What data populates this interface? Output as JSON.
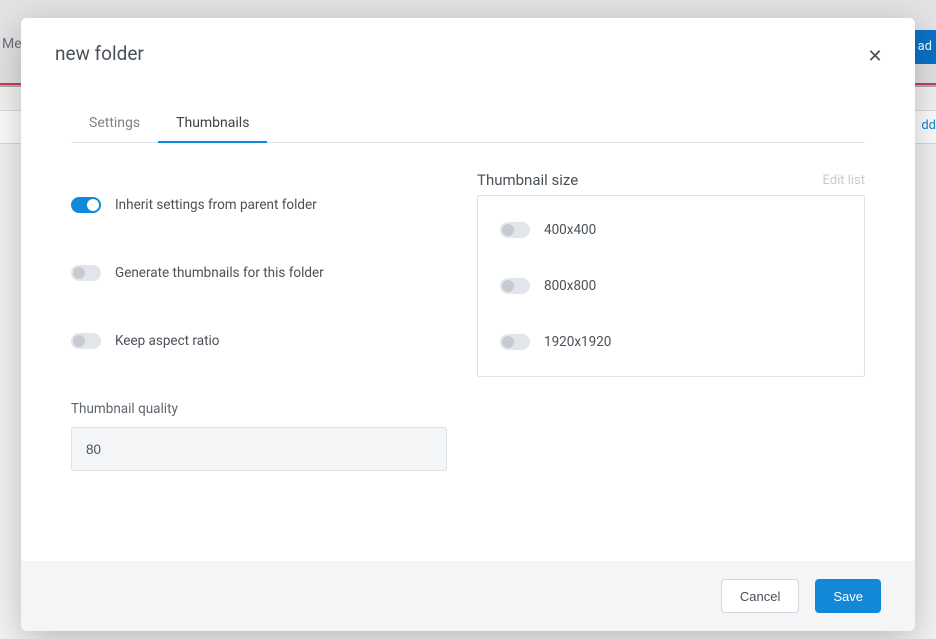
{
  "background": {
    "left_text": "Me",
    "right_button_fragment": "ad",
    "right_link_fragment": "dd"
  },
  "modal": {
    "title": "new folder",
    "close_icon": "✕",
    "tabs": {
      "settings": "Settings",
      "thumbnails": "Thumbnails"
    },
    "toggles": {
      "inherit": {
        "label": "Inherit settings from parent folder",
        "on": true
      },
      "generate": {
        "label": "Generate thumbnails for this folder",
        "on": false
      },
      "aspect": {
        "label": "Keep aspect ratio",
        "on": false
      }
    },
    "quality": {
      "label": "Thumbnail quality",
      "value": "80"
    },
    "sizes": {
      "title": "Thumbnail size",
      "edit_link": "Edit list",
      "items": [
        {
          "label": "400x400",
          "on": false
        },
        {
          "label": "800x800",
          "on": false
        },
        {
          "label": "1920x1920",
          "on": false
        }
      ]
    },
    "footer": {
      "cancel": "Cancel",
      "save": "Save"
    }
  }
}
